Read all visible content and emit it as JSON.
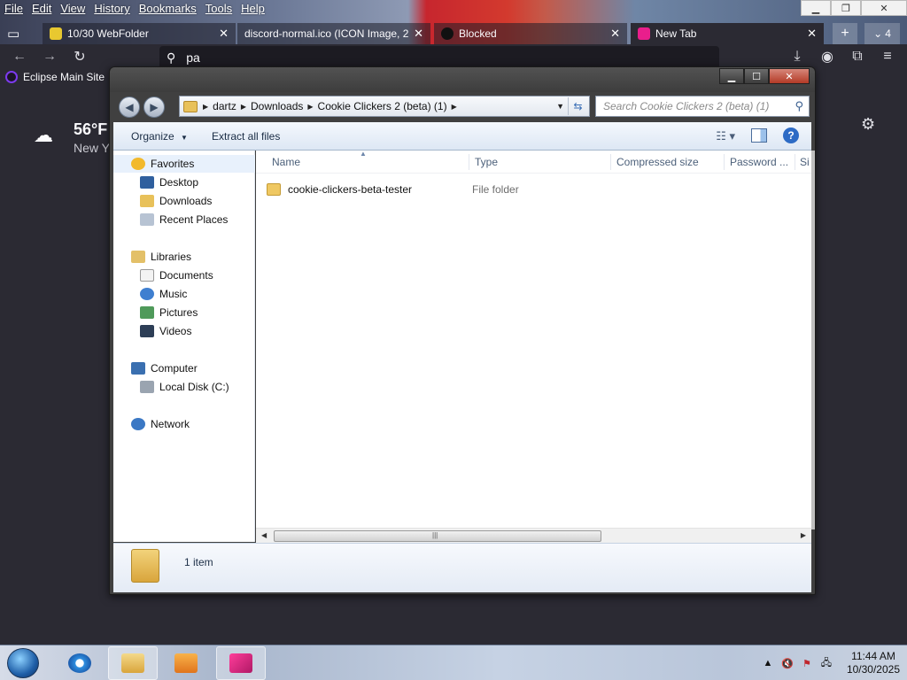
{
  "browser": {
    "menu": [
      "File",
      "Edit",
      "View",
      "History",
      "Bookmarks",
      "Tools",
      "Help"
    ],
    "tabs": [
      {
        "label": "10/30 WebFolder",
        "icon_color": "#e8c830"
      },
      {
        "label": "discord-normal.ico (ICON Image, 2",
        "icon_color": "#6c6c7a"
      },
      {
        "label": "Blocked",
        "icon_color": "#111111"
      },
      {
        "label": "New Tab",
        "icon_color": "#e91e8c"
      }
    ],
    "tab_count": "4",
    "url_text": "pa",
    "bookmark_label": "Eclipse Main Site",
    "weather_temp": "56°F",
    "weather_city": "New Y"
  },
  "explorer": {
    "breadcrumbs": [
      "dartz",
      "Downloads",
      "Cookie Clickers 2 (beta) (1)"
    ],
    "search_placeholder": "Search Cookie Clickers 2 (beta) (1)",
    "commands": {
      "organize": "Organize",
      "extract": "Extract all files"
    },
    "nav": {
      "favorites": {
        "label": "Favorites",
        "items": [
          "Desktop",
          "Downloads",
          "Recent Places"
        ]
      },
      "libraries": {
        "label": "Libraries",
        "items": [
          "Documents",
          "Music",
          "Pictures",
          "Videos"
        ]
      },
      "computer": {
        "label": "Computer",
        "items": [
          "Local Disk (C:)"
        ]
      },
      "network": {
        "label": "Network"
      }
    },
    "columns": [
      "Name",
      "Type",
      "Compressed size",
      "Password ...",
      "Si"
    ],
    "files": [
      {
        "name": "cookie-clickers-beta-tester",
        "type": "File folder"
      }
    ],
    "status": "1 item"
  },
  "taskbar": {
    "time": "11:44 AM",
    "date": "10/30/2025"
  },
  "colors": {
    "browser_bg": "#2b2a33",
    "explorer_frame": "#404040",
    "selection": "#e8f1fc",
    "link_blue": "#2d6bc5"
  }
}
